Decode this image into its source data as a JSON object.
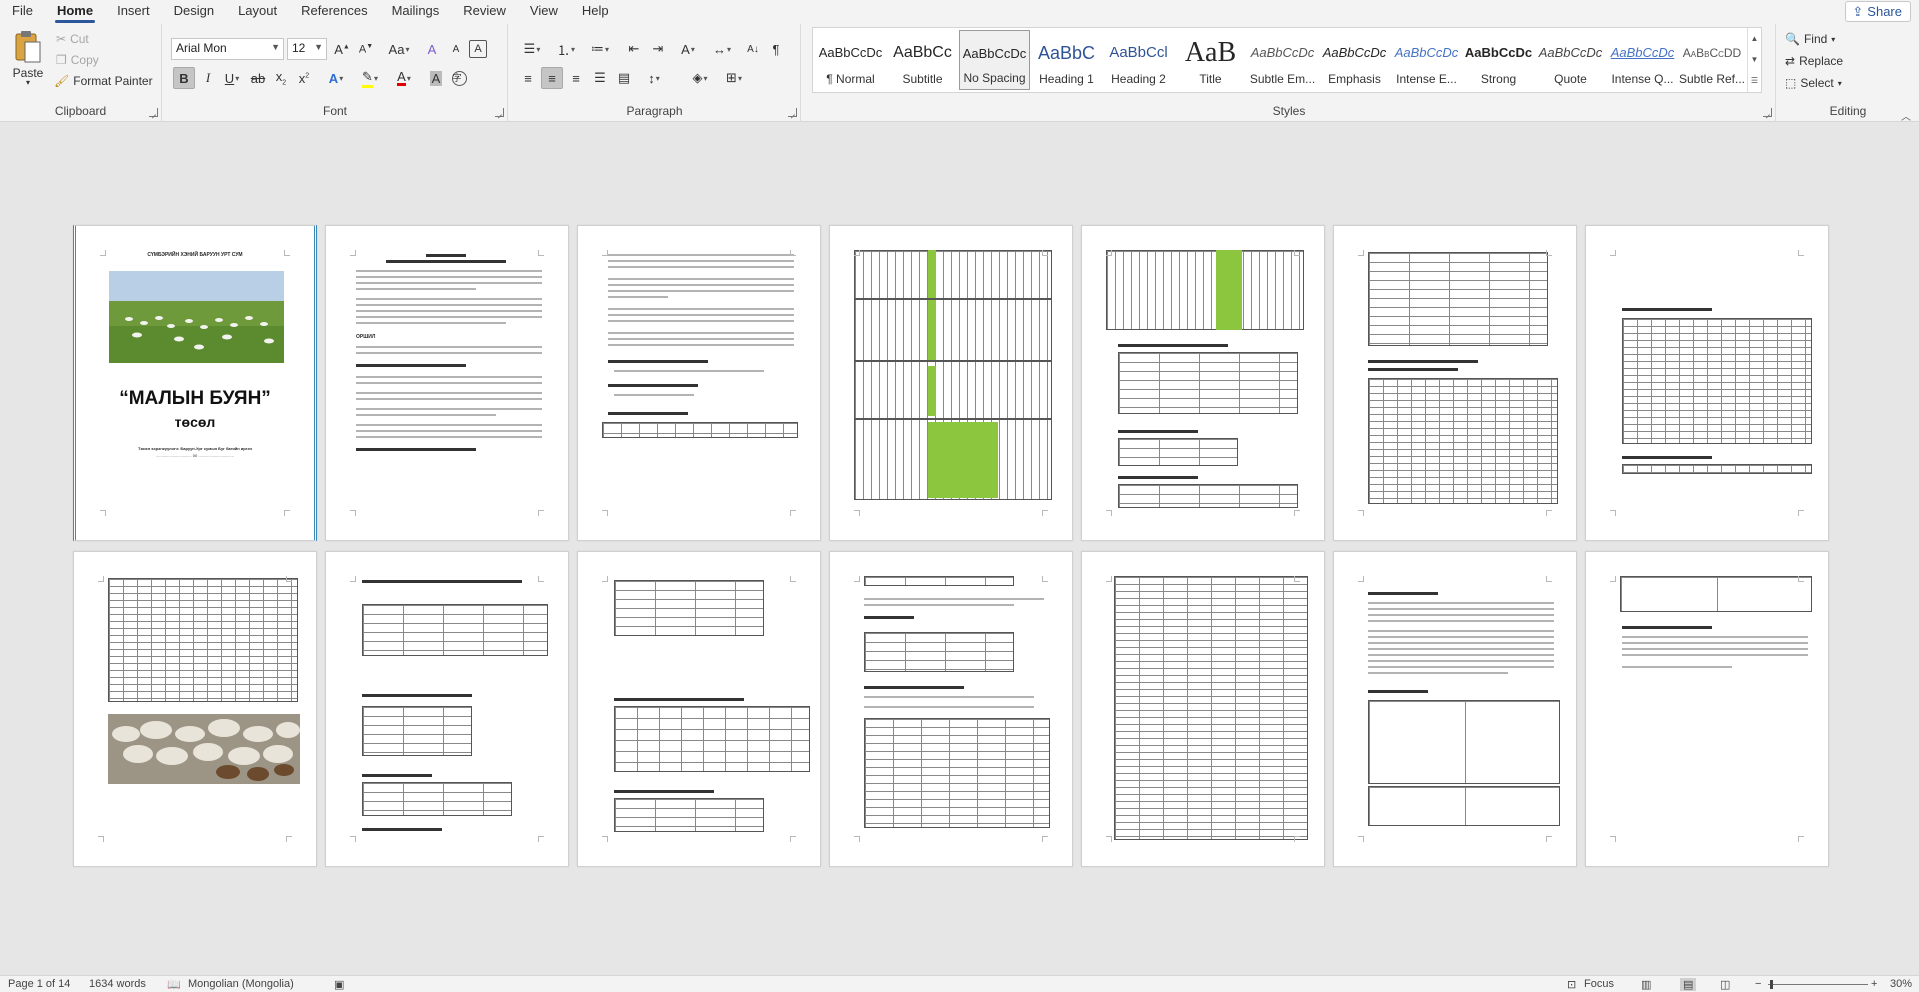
{
  "tabs": [
    "File",
    "Home",
    "Insert",
    "Design",
    "Layout",
    "References",
    "Mailings",
    "Review",
    "View",
    "Help"
  ],
  "active_tab": "Home",
  "share_label": "Share",
  "clipboard": {
    "paste": "Paste",
    "cut": "Cut",
    "copy": "Copy",
    "format_painter": "Format Painter",
    "label": "Clipboard"
  },
  "font": {
    "name": "Arial Mon",
    "size": "12",
    "label": "Font"
  },
  "paragraph": {
    "label": "Paragraph"
  },
  "styles": {
    "label": "Styles",
    "items": [
      {
        "preview": "AaBbCcDc",
        "name": "¶ Normal"
      },
      {
        "preview": "AaBbCc",
        "name": "Subtitle"
      },
      {
        "preview": "AaBbCcDc",
        "name": "No Spacing"
      },
      {
        "preview": "AaBbC",
        "name": "Heading 1"
      },
      {
        "preview": "AaBbCcl",
        "name": "Heading 2"
      },
      {
        "preview": "AaB",
        "name": "Title"
      },
      {
        "preview": "AaBbCcDc",
        "name": "Subtle Em..."
      },
      {
        "preview": "AaBbCcDc",
        "name": "Emphasis"
      },
      {
        "preview": "AaBbCcDc",
        "name": "Intense E..."
      },
      {
        "preview": "AaBbCcDc",
        "name": "Strong"
      },
      {
        "preview": "AaBbCcDc",
        "name": "Quote"
      },
      {
        "preview": "AaBbCcDc",
        "name": "Intense Q..."
      },
      {
        "preview": "AaBbCcDD",
        "name": "Subtle Ref..."
      }
    ]
  },
  "editing": {
    "find": "Find",
    "replace": "Replace",
    "select": "Select",
    "label": "Editing"
  },
  "cover": {
    "top_line": "СҮМБЭРИЙН ХЭНИЙ БАРУУН УРТ СУМ",
    "title": "“МАЛЫН БУЯН”",
    "subtitle": "төсөл",
    "note": "Төсөл хэрэгжүүлэгч: Баруун-Урт сумын Буг багийн иргэн",
    "note2": "................................ 00 ................................"
  },
  "page2": {
    "heading": "ОРШИЛ"
  },
  "status": {
    "page": "Page 1 of 14",
    "words": "1634 words",
    "language": "Mongolian (Mongolia)",
    "focus": "Focus",
    "zoom": "30%"
  },
  "colors": {
    "accent": "#2b579a",
    "table_green": "#8cc63f",
    "cover_border": "#3a8ab8"
  }
}
